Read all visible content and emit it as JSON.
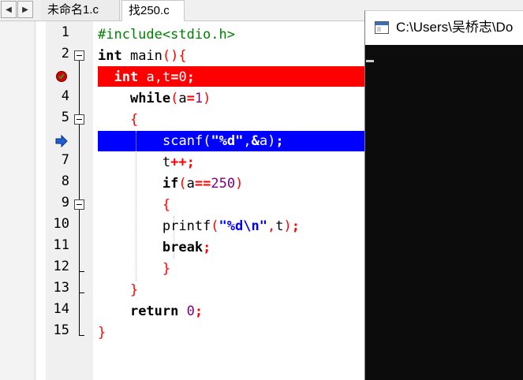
{
  "tabs": {
    "scroll_left": "◀",
    "scroll_right": "▶",
    "items": [
      {
        "label": "未命名1.c",
        "active": false
      },
      {
        "label": "找250.c",
        "active": true
      }
    ]
  },
  "editor": {
    "line_numbers": [
      "1",
      "2",
      "3",
      "4",
      "5",
      "6",
      "7",
      "8",
      "9",
      "10",
      "11",
      "12",
      "13",
      "14",
      "15"
    ],
    "breakpoint_line": 3,
    "execution_line": 6,
    "colors": {
      "breakpoint": "#ff0000",
      "execution": "#0000ff"
    },
    "lines": [
      "#include<stdio.h>",
      "int main(){",
      "  int a,t=0;",
      "    while(a=1)",
      "    {",
      "        scanf(\"%d\",&a);",
      "        t++;",
      "        if(a==250)",
      "        {",
      "        printf(\"%d\\n\",t);",
      "        break;",
      "        }",
      "    }",
      "    return 0;",
      "}"
    ]
  },
  "console": {
    "title": "C:\\Users\\吴桥志\\Do",
    "icon": "console-window-icon",
    "background": "#0c0c0c"
  }
}
